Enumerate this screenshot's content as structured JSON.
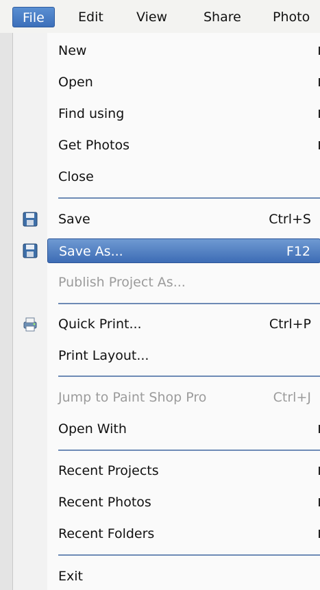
{
  "menubar": {
    "items": [
      {
        "label": "File",
        "mnemonic": "F"
      },
      {
        "label": "Edit",
        "mnemonic": "E"
      },
      {
        "label": "View",
        "mnemonic": "V"
      },
      {
        "label": "Share",
        "mnemonic": "S"
      },
      {
        "label": "Photo",
        "mnemonic": "P"
      }
    ]
  },
  "file_menu": {
    "new": {
      "label": "New"
    },
    "open": {
      "label": "Open"
    },
    "find_using": {
      "label": "Find using"
    },
    "get_photos": {
      "label": "Get Photos"
    },
    "close": {
      "label": "Close"
    },
    "save": {
      "label": "Save",
      "shortcut": "Ctrl+S",
      "icon": "floppy-disk-icon"
    },
    "save_as": {
      "label": "Save As...",
      "shortcut": "F12",
      "icon": "floppy-disk-icon"
    },
    "publish_project_as": {
      "label": "Publish Project As..."
    },
    "quick_print": {
      "label": "Quick Print...",
      "shortcut": "Ctrl+P",
      "icon": "printer-icon"
    },
    "print_layout": {
      "label": "Print Layout..."
    },
    "jump_to_psp": {
      "label": "Jump to Paint Shop Pro",
      "shortcut": "Ctrl+J"
    },
    "open_with": {
      "label": "Open With"
    },
    "recent_projects": {
      "label": "Recent Projects"
    },
    "recent_photos": {
      "label": "Recent Photos"
    },
    "recent_folders": {
      "label": "Recent Folders"
    },
    "exit": {
      "label": "Exit"
    }
  },
  "colors": {
    "highlight": "#4a79c0",
    "separator": "#6d8ab5",
    "disabled_text": "#9b9b9b"
  }
}
